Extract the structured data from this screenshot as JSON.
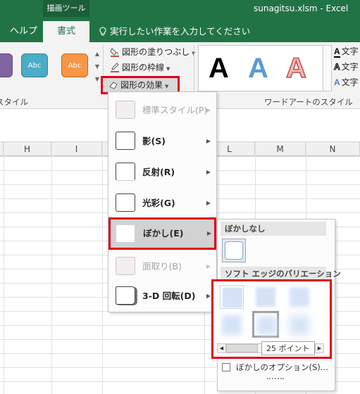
{
  "titlebar": {
    "context_tab": "描画ツール",
    "document_title": "sunagitsu.xlsm  -  Excel"
  },
  "tabs": {
    "help": "ヘルプ",
    "format": "書式",
    "tell_me": "実行したい作業を入力してください"
  },
  "ribbon": {
    "style_swatches": [
      {
        "label": "",
        "color": "#8064a2"
      },
      {
        "label": "Abc",
        "color": "#4bacc6"
      },
      {
        "label": "Abc",
        "color": "#f79646"
      }
    ],
    "shape_fill": "図形の塗りつぶし",
    "shape_outline": "図形の枠線",
    "shape_effects": "図形の効果",
    "group_shape_styles": "スタイル",
    "wordart_samples": [
      "A",
      "A",
      "A"
    ],
    "group_wordart": "ワードアートのスタイル",
    "text_cmds": [
      "文字",
      "文字",
      "文字"
    ]
  },
  "columns": [
    "H",
    "I",
    "L",
    "M",
    "N"
  ],
  "effects_menu": {
    "items": [
      {
        "label": "標準スタイル(P)",
        "disabled": true
      },
      {
        "label": "影(S)",
        "disabled": false
      },
      {
        "label": "反射(R)",
        "disabled": false
      },
      {
        "label": "光彩(G)",
        "disabled": false
      },
      {
        "label": "ぼかし(E)",
        "disabled": false,
        "highlighted": true
      },
      {
        "label": "面取り(B)",
        "disabled": true
      },
      {
        "label": "3-D 回転(D)",
        "disabled": false
      }
    ]
  },
  "soft_edges_submenu": {
    "no_soft_edges_header": "ぼかしなし",
    "variations_header": "ソフト エッジのバリエーション",
    "tooltip": "25 ポイント",
    "options": "ぼかしのオプション(S)..."
  },
  "colors": {
    "excel_green": "#217346",
    "highlight_red": "#e0001b"
  }
}
